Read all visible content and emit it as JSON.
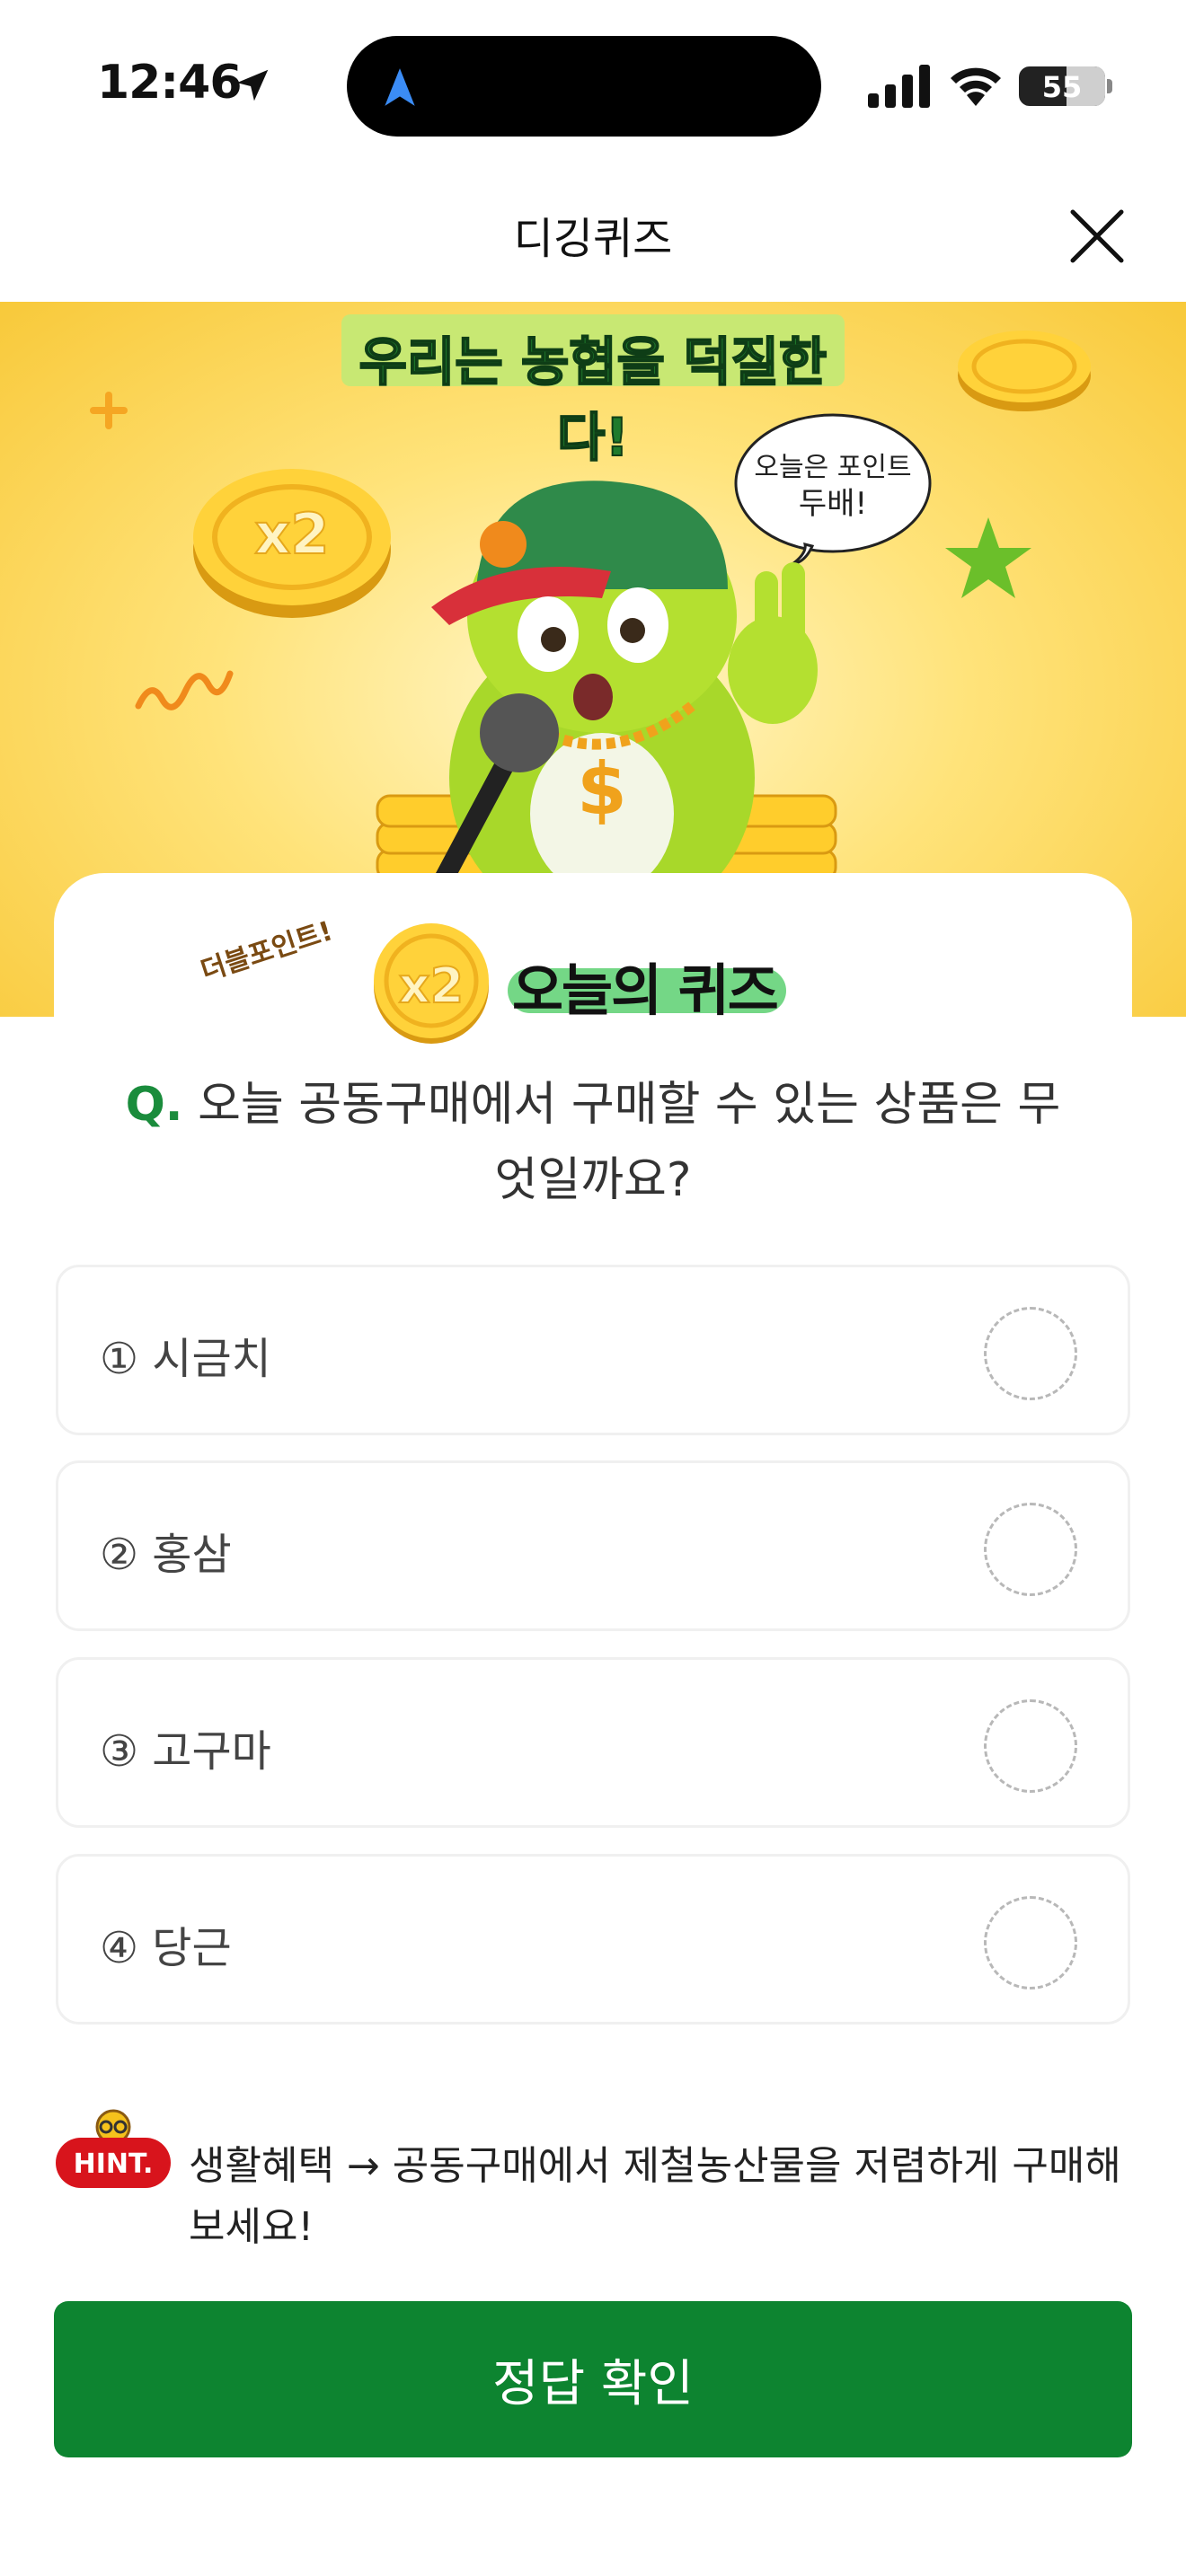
{
  "status_bar": {
    "time": "12:46",
    "battery": "55",
    "battery_fraction": 0.55
  },
  "header": {
    "title": "디깅퀴즈"
  },
  "banner": {
    "title": "우리는 농협을 덕질한다!",
    "speech": [
      "오늘은 포인트",
      "두배!"
    ],
    "coin_label": "x2"
  },
  "quiz_card": {
    "badge_tag": "더블포인트!",
    "badge_coin_label": "x2",
    "badge_title": "오늘의 퀴즈",
    "question_prefix": "Q.",
    "question_line1": "오늘 공동구매에서 구매할 수 있는 상품은 무",
    "question_line2": "엇일까요?",
    "options": [
      {
        "label": "① 시금치"
      },
      {
        "label": "② 홍삼"
      },
      {
        "label": "③ 고구마"
      },
      {
        "label": "④ 당근"
      }
    ],
    "hint_badge": "HINT.",
    "hint_text": "생활혜택 → 공동구매에서 제철농산물을 저렴하게 구매해 보세요!",
    "submit_label": "정답 확인"
  },
  "colors": {
    "primary_green": "#0d8430",
    "hint_red": "#d8141c",
    "banner_yellow": "#ffe37a"
  }
}
